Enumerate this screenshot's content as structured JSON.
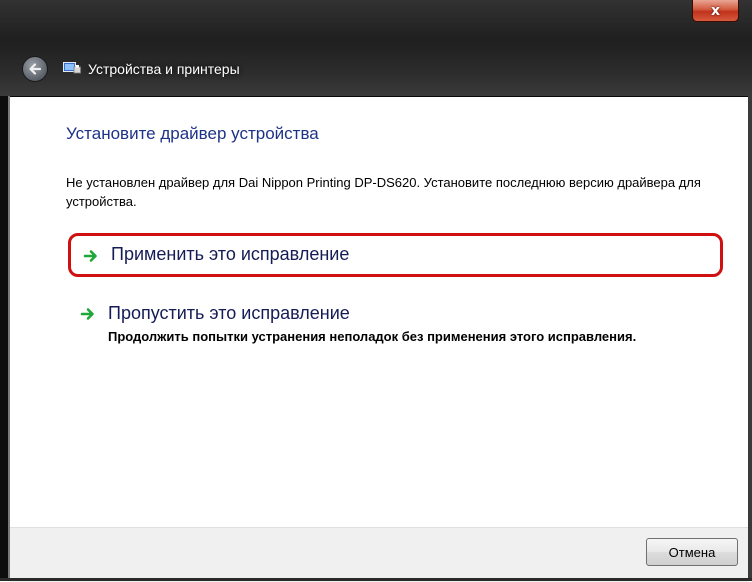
{
  "window": {
    "title": "Устройства и принтеры",
    "close_label": "x"
  },
  "main": {
    "heading": "Установите драйвер устройства",
    "description": "Не установлен драйвер для Dai Nippon Printing DP-DS620. Установите последнюю версию драйвера для устройства.",
    "options": [
      {
        "title": "Применить это исправление",
        "subtitle": ""
      },
      {
        "title": "Пропустить это исправление",
        "subtitle": "Продолжить попытки устранения неполадок без применения этого исправления."
      }
    ]
  },
  "footer": {
    "cancel_label": "Отмена"
  },
  "colors": {
    "heading": "#1e3287",
    "option_title": "#151c55",
    "highlight": "#d01010",
    "arrow": "#1fa83a"
  },
  "icons": {
    "back": "back-arrow-icon",
    "app": "devices-printers-icon",
    "option": "green-arrow-icon",
    "close": "close-icon"
  }
}
